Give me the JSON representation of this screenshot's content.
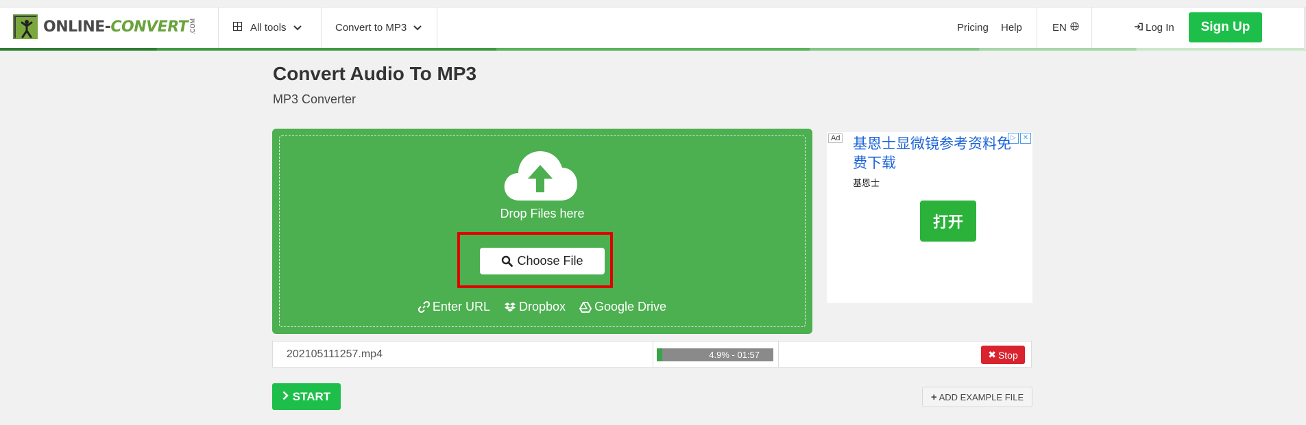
{
  "header": {
    "logo_text_a": "ONLINE-",
    "logo_text_b": "CONVERT",
    "logo_com": ".COM",
    "all_tools_label": "All tools",
    "convert_to_label": "Convert to MP3",
    "pricing_label": "Pricing",
    "help_label": "Help",
    "language_label": "EN",
    "login_label": "Log In",
    "signup_label": "Sign Up"
  },
  "main": {
    "title": "Convert Audio To MP3",
    "subtitle": "MP3 Converter"
  },
  "upload": {
    "drop_label": "Drop Files here",
    "choose_file_label": "Choose File",
    "sources": {
      "url": "Enter URL",
      "dropbox": "Dropbox",
      "google_drive": "Google Drive"
    }
  },
  "ad": {
    "badge": "Ad",
    "title": "基恩士显微镜参考资料免费下载",
    "brand": "基恩士",
    "button": "打开"
  },
  "file": {
    "name": "202105111257.mp4",
    "progress_percent": 4.9,
    "progress_text": "4.9% - 01:57",
    "stop_label": "Stop"
  },
  "actions": {
    "start_label": "START",
    "add_example_label": "ADD EXAMPLE FILE"
  },
  "colors": {
    "brand_green": "#4caf50",
    "signup_green": "#1dbf4a",
    "highlight_red": "#e00000",
    "stop_red": "#d9232e",
    "ad_link_blue": "#1a63d8"
  }
}
